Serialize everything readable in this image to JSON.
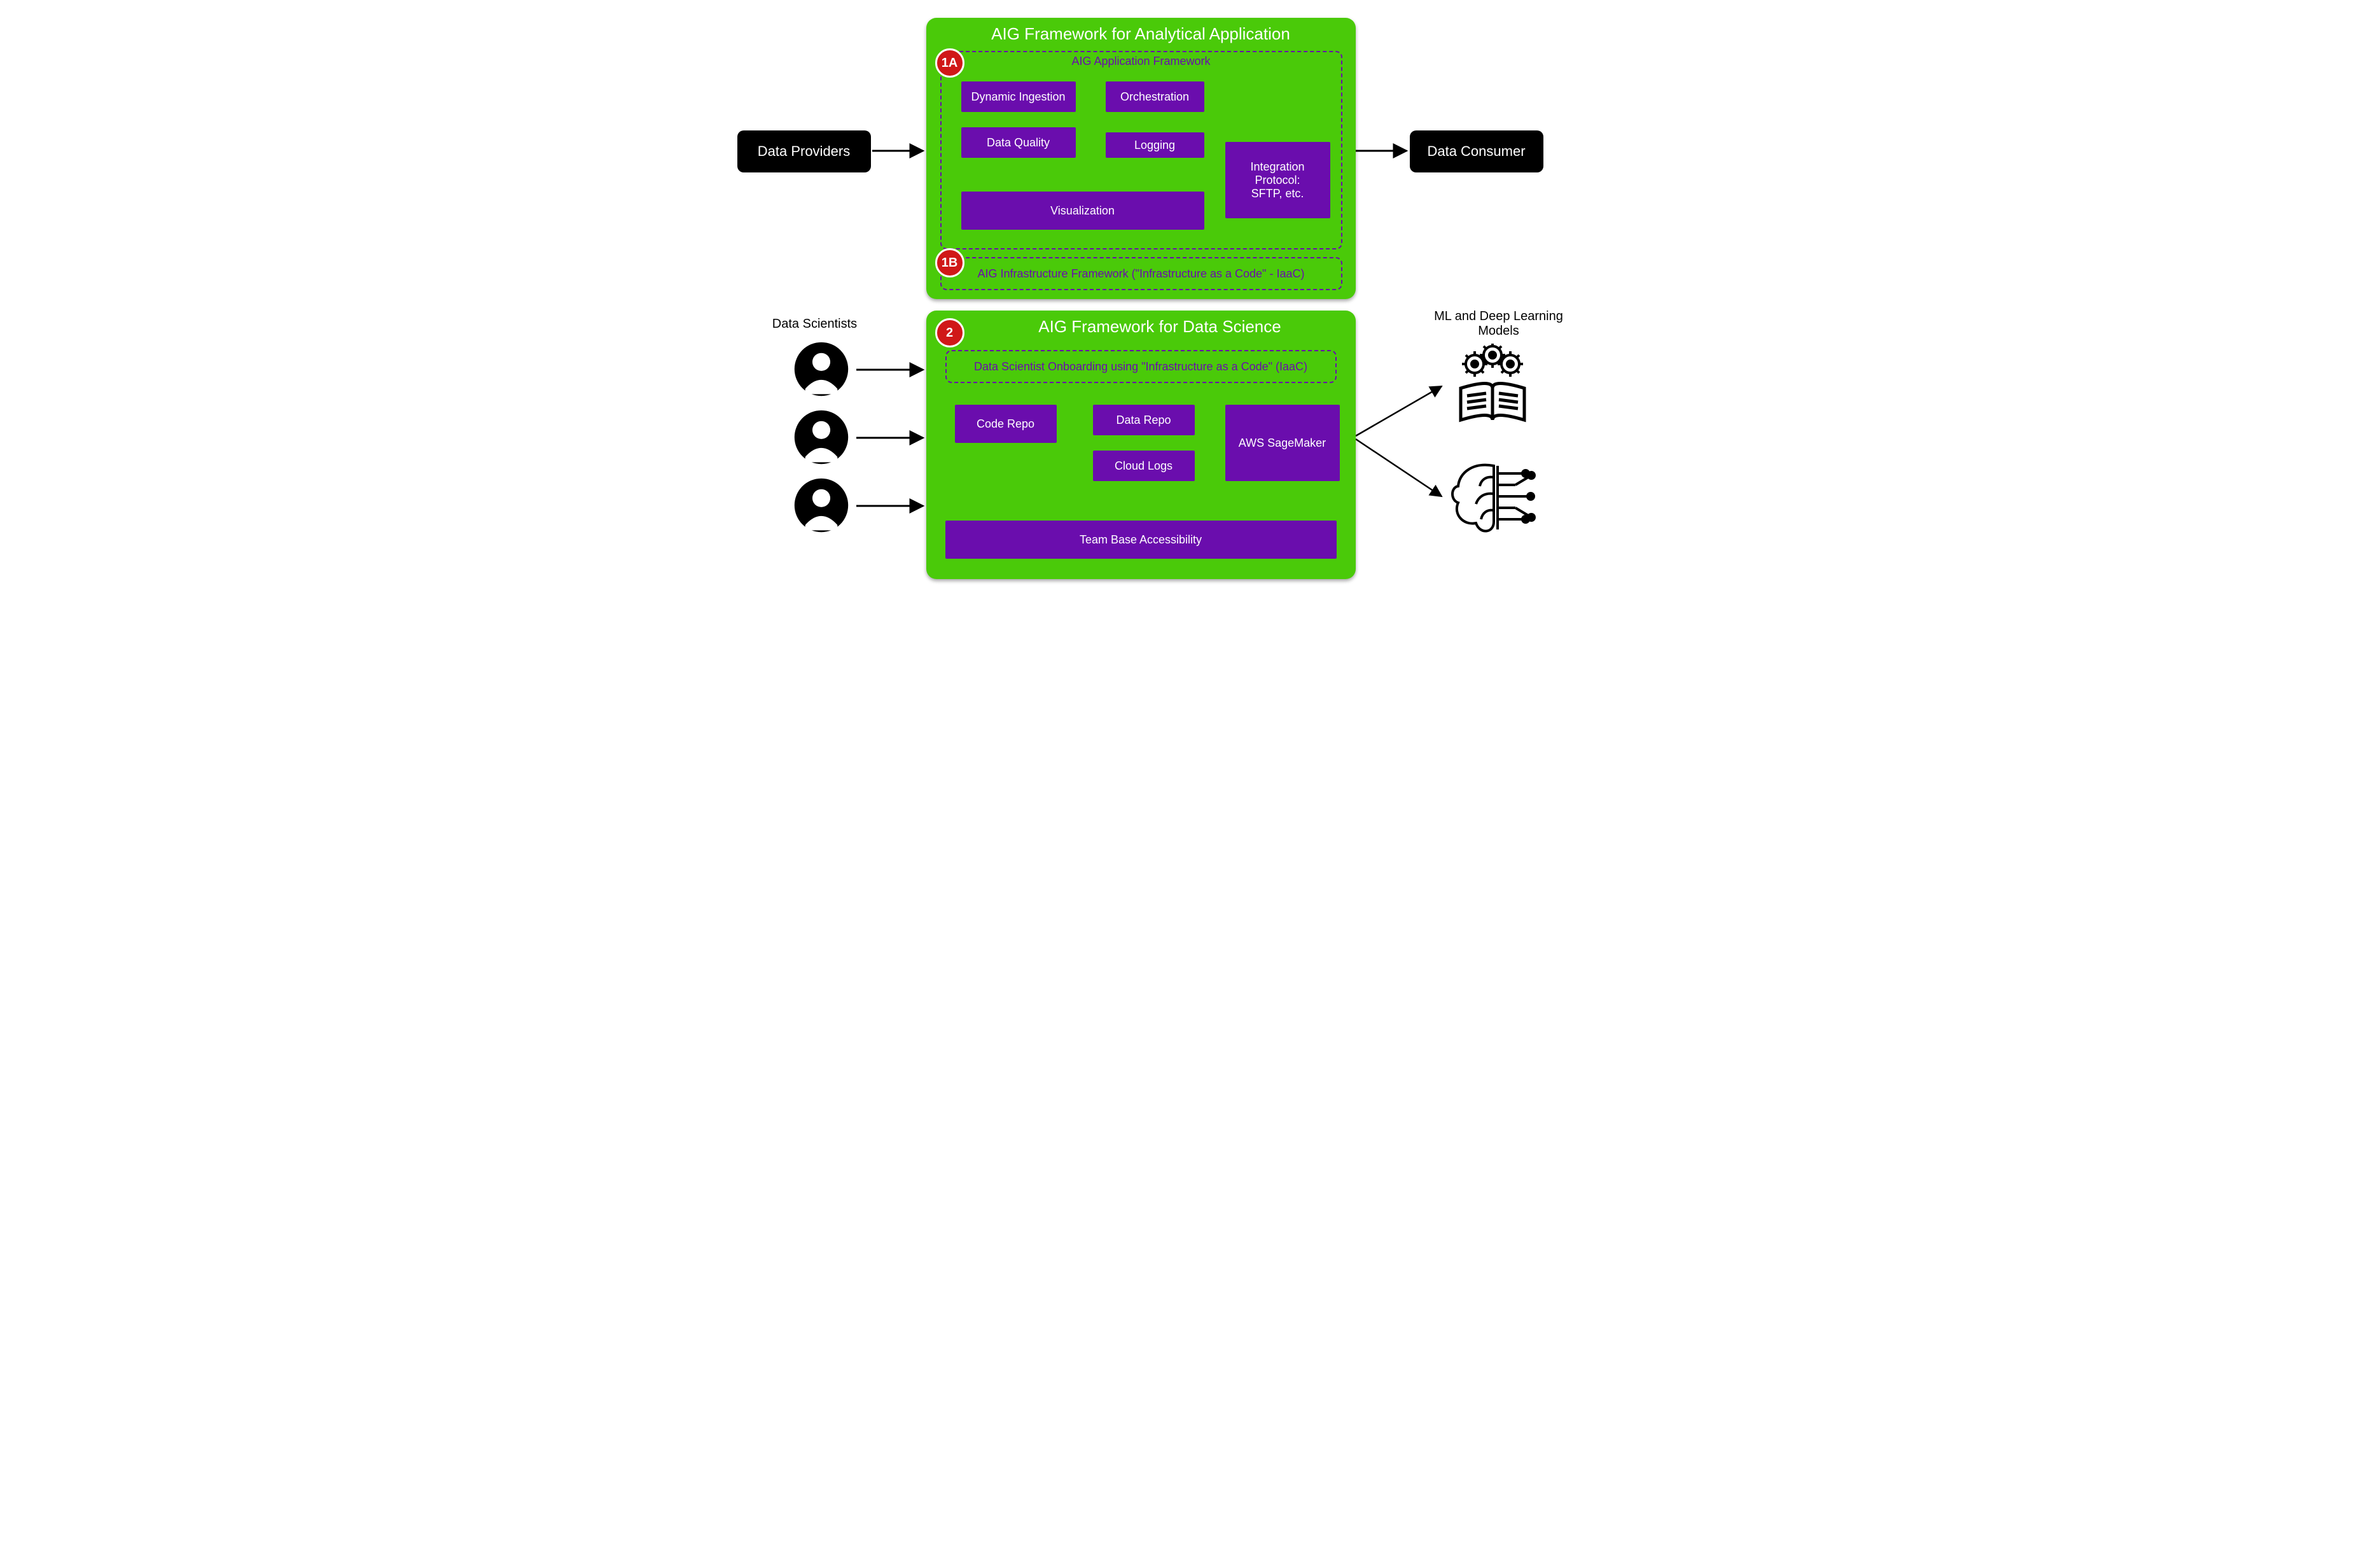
{
  "left": {
    "data_providers": "Data Providers",
    "data_scientists_label": "Data Scientists"
  },
  "right": {
    "data_consumer": "Data Consumer",
    "ml_models_label": "ML and Deep Learning\nModels"
  },
  "panel1": {
    "title": "AIG Framework for Analytical Application",
    "section_a": {
      "badge": "1A",
      "title": "AIG Application Framework",
      "boxes": {
        "dyn_ingestion": "Dynamic Ingestion",
        "orchestration": "Orchestration",
        "data_quality": "Data Quality",
        "logging": "Logging",
        "visualization": "Visualization",
        "integration": "Integration\nProtocol:\nSFTP, etc."
      }
    },
    "section_b": {
      "badge": "1B",
      "title": "AIG Infrastructure Framework  (\"Infrastructure as a Code\" - IaaC)"
    }
  },
  "panel2": {
    "badge": "2",
    "title": "AIG Framework for Data Science",
    "onboarding": "Data Scientist Onboarding using \"Infrastructure as a Code\" (IaaC)",
    "boxes": {
      "code_repo": "Code Repo",
      "data_repo": "Data Repo",
      "cloud_logs": "Cloud Logs",
      "sagemaker": "AWS SageMaker",
      "accessibility": "Team Base Accessibility"
    }
  },
  "colors": {
    "green": "#4aca09",
    "purple": "#6a0dad",
    "black": "#000000",
    "red": "#d01818",
    "white": "#ffffff"
  }
}
